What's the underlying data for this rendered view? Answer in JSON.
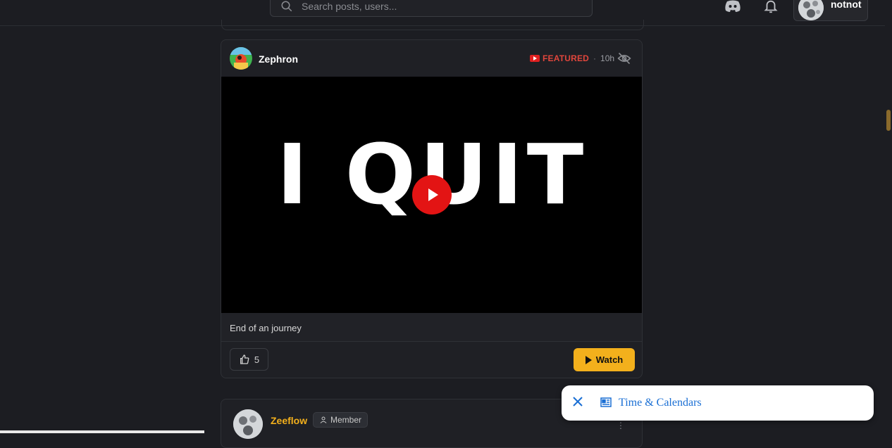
{
  "search": {
    "placeholder": "Search posts, users..."
  },
  "header": {
    "username": "notnot"
  },
  "post": {
    "author": "Zephron",
    "featured_label": "FEATURED",
    "separator": "·",
    "time": "10h",
    "video_text": "I QUIT",
    "caption": "End of an journey",
    "likes": "5",
    "watch_label": "Watch"
  },
  "next_post": {
    "author": "Zeeflow",
    "badge": "Member"
  },
  "toast": {
    "title": "Time & Calendars"
  },
  "colors": {
    "accent": "#f3b01c",
    "featured": "#e0463c",
    "youtube": "#e31414",
    "link": "#1a6fd4"
  },
  "icons": [
    "search-icon",
    "discord-icon",
    "bell-icon",
    "youtube-icon",
    "eye-off-icon",
    "play-icon",
    "thumbs-up-icon",
    "user-icon",
    "more-vertical-icon",
    "close-icon",
    "newspaper-icon"
  ]
}
